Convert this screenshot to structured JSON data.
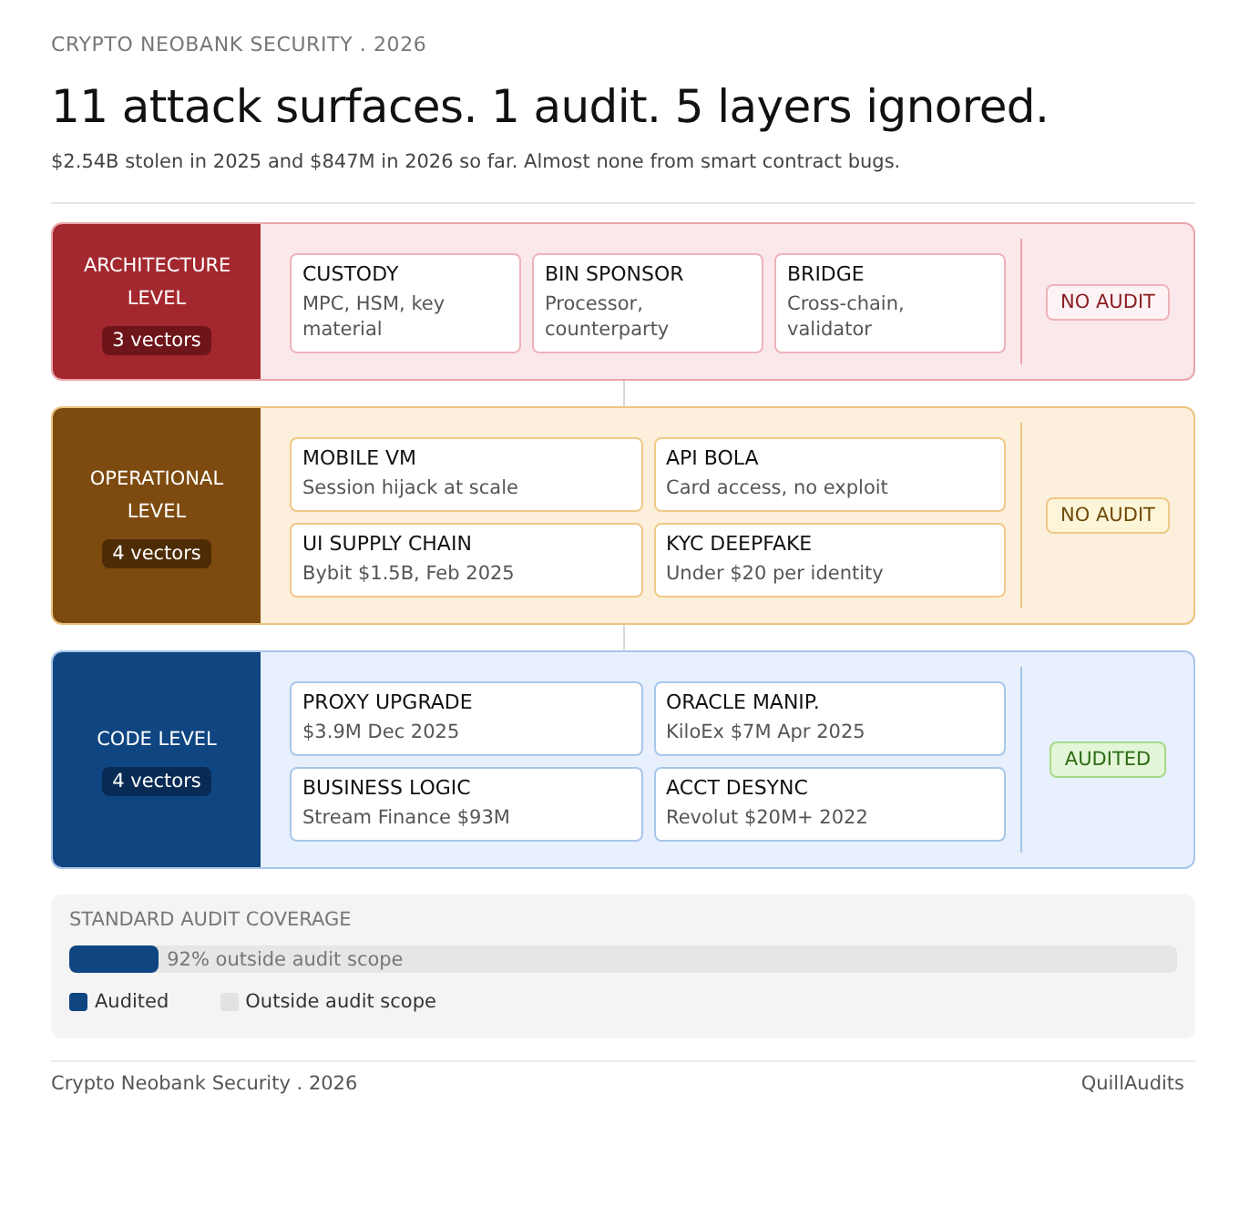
{
  "eyebrow": "CRYPTO NEOBANK SECURITY . 2026",
  "title": "11 attack surfaces. 1 audit. 5 layers ignored.",
  "subtitle": "$2.54B stolen in 2025 and $847M in 2026 so far. Almost none from smart contract bugs.",
  "layers": [
    {
      "kind": "architecture",
      "name": "ARCHITECTURE LEVEL",
      "count": "3 vectors",
      "audit": "NO AUDIT",
      "audited": false,
      "vectors": [
        {
          "title": "CUSTODY",
          "detail": "MPC, HSM, key material"
        },
        {
          "title": "BIN SPONSOR",
          "detail": "Processor, counterparty"
        },
        {
          "title": "BRIDGE",
          "detail": "Cross-chain, validator"
        }
      ]
    },
    {
      "kind": "operational",
      "name": "OPERATIONAL LEVEL",
      "count": "4 vectors",
      "audit": "NO AUDIT",
      "audited": false,
      "vectors": [
        {
          "title": "MOBILE VM",
          "detail": "Session hijack at scale"
        },
        {
          "title": "API BOLA",
          "detail": "Card access, no exploit"
        },
        {
          "title": "UI SUPPLY CHAIN",
          "detail": "Bybit $1.5B, Feb 2025"
        },
        {
          "title": "KYC DEEPFAKE",
          "detail": "Under $20 per identity"
        }
      ]
    },
    {
      "kind": "code",
      "name": "CODE LEVEL",
      "count": "4 vectors",
      "audit": "AUDITED",
      "audited": true,
      "vectors": [
        {
          "title": "PROXY UPGRADE",
          "detail": "$3.9M Dec 2025"
        },
        {
          "title": "ORACLE MANIP.",
          "detail": "KiloEx $7M Apr 2025"
        },
        {
          "title": "BUSINESS LOGIC",
          "detail": "Stream Finance $93M"
        },
        {
          "title": "ACCT DESYNC",
          "detail": "Revolut $20M+ 2022"
        }
      ]
    }
  ],
  "coverage": {
    "heading": "STANDARD AUDIT COVERAGE",
    "level": 0.08,
    "reading": "92% outside audit scope",
    "legend": [
      {
        "label": "Audited",
        "color": "#0f4581"
      },
      {
        "label": "Outside audit scope",
        "color": "#e2e2e2"
      }
    ]
  },
  "footer": {
    "left": "Crypto Neobank Security . 2026",
    "right": "QuillAudits"
  }
}
